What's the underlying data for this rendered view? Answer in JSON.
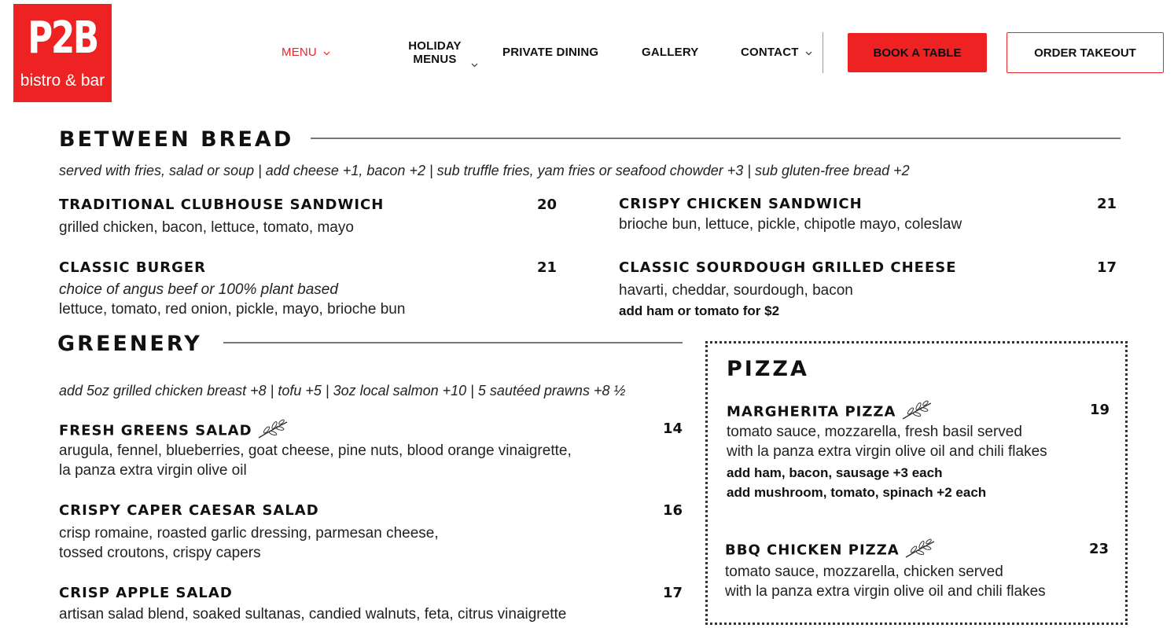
{
  "logo": {
    "brand": "P2B",
    "tagline": "bistro & bar"
  },
  "nav": {
    "menu": "MENU",
    "holiday_line1": "HOLIDAY",
    "holiday_line2": "MENUS",
    "private_dining": "PRIVATE DINING",
    "gallery": "GALLERY",
    "contact": "CONTACT",
    "book": "BOOK A TABLE",
    "order": "ORDER TAKEOUT"
  },
  "colors": {
    "brand_red": "#ee2222",
    "active_red": "#e8262b"
  },
  "between_bread": {
    "title": "BETWEEN BREAD",
    "note": "served with fries, salad or soup  |  add cheese +1, bacon +2 | sub truffle fries, yam fries or seafood chowder +3 | sub gluten-free bread +2",
    "items": [
      {
        "name": "TRADITIONAL CLUBHOUSE SANDWICH",
        "price": "20",
        "desc1": "grilled chicken, bacon, lettuce, tomato, mayo"
      },
      {
        "name": "CRISPY CHICKEN SANDWICH",
        "price": "21",
        "desc1": "brioche bun, lettuce, pickle, chipotle mayo, coleslaw"
      },
      {
        "name": "CLASSIC BURGER",
        "price": "21",
        "desc1": "choice of angus beef or 100% plant based",
        "desc2": "lettuce, tomato, red onion, pickle, mayo, brioche bun"
      },
      {
        "name": "CLASSIC SOURDOUGH GRILLED CHEESE",
        "price": "17",
        "desc1": "havarti, cheddar, sourdough, bacon",
        "desc2": "add ham or tomato for $2"
      }
    ]
  },
  "greenery": {
    "title": "GREENERY",
    "note": "add 5oz grilled chicken breast +8  |  tofu +5 | 3oz local salmon +10  |  5 sautéed prawns +8 ½",
    "items": [
      {
        "name": "FRESH GREENS SALAD",
        "price": "14",
        "desc1": "arugula, fennel, blueberries, goat cheese, pine nuts, blood orange vinaigrette,",
        "desc2": "la panza extra virgin olive oil"
      },
      {
        "name": "CRISPY CAPER CAESAR SALAD",
        "price": "16",
        "desc1": "crisp romaine, roasted garlic dressing, parmesan cheese,",
        "desc2": "tossed croutons, crispy capers"
      },
      {
        "name": "CRISP APPLE SALAD",
        "price": "17",
        "desc1": "artisan salad blend, soaked sultanas, candied walnuts, feta, citrus vinaigrette"
      }
    ]
  },
  "pizza": {
    "title": "PIZZA",
    "items": [
      {
        "name": "MARGHERITA PIZZA",
        "price": "19",
        "desc1": "tomato sauce, mozzarella, fresh basil served",
        "desc2": "with la panza extra virgin olive oil and chili flakes",
        "add1": "add ham, bacon, sausage +3 each",
        "add2": "add mushroom, tomato, spinach +2 each"
      },
      {
        "name": "BBQ CHICKEN PIZZA",
        "price": "23",
        "desc1": "tomato sauce, mozzarella, chicken served",
        "desc2": "with la panza extra virgin olive oil and chili flakes"
      }
    ]
  },
  "icons": {
    "chevron": "chevron-down-icon",
    "vegetarian": "olive-branch-icon"
  }
}
